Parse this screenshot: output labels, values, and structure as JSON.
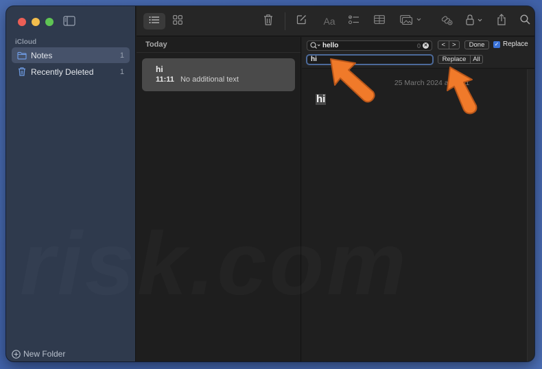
{
  "window": {
    "traffic_lights": [
      "close",
      "minimize",
      "zoom"
    ]
  },
  "sidebar": {
    "section_label": "iCloud",
    "items": [
      {
        "label": "Notes",
        "count": "1",
        "icon": "folder-icon",
        "active": true
      },
      {
        "label": "Recently Deleted",
        "count": "1",
        "icon": "trash-icon",
        "active": false
      }
    ],
    "new_folder_label": "New Folder"
  },
  "toolbar": {
    "buttons": [
      "list-view",
      "gallery-view",
      "delete",
      "compose",
      "format",
      "checklist",
      "table",
      "media",
      "collaborate",
      "lock",
      "share",
      "search"
    ]
  },
  "list": {
    "header": "Today",
    "notes": [
      {
        "title": "hi",
        "time": "11:11",
        "preview": "No additional text"
      }
    ]
  },
  "find": {
    "search_value": "hello",
    "match_count": "0",
    "replace_value": "hi",
    "done_label": "Done",
    "replace_checkbox_label": "Replace",
    "replace_checked": true,
    "replace_button": "Replace",
    "all_button": "All",
    "prev_glyph": "<",
    "next_glyph": ">"
  },
  "editor": {
    "date": "25 March 2024 at 11:11",
    "body": "hi"
  },
  "colors": {
    "accent": "#3b73d9",
    "annotation_arrow": "#f07a2a",
    "sidebar_bg": "#2f3a4d"
  },
  "watermark": "risk.com"
}
